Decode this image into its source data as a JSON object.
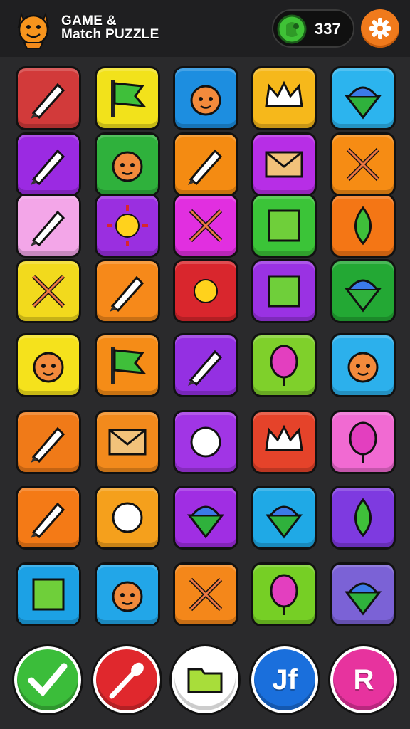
{
  "header": {
    "title_line1": "GAME &",
    "title_line2": "Match PUZZLE",
    "coin_count": "337"
  },
  "colors": {
    "background": "#2a2a2c",
    "topbar": "#1f1f21",
    "settings": "#f07a1c",
    "coin": "#3fc236"
  },
  "grid_tiles": [
    {
      "icon": "marker-icon",
      "bg": "#d23a3a"
    },
    {
      "icon": "green-flag-icon",
      "bg": "#f2e21b"
    },
    {
      "icon": "horse-chess-icon",
      "bg": "#1d8ee0"
    },
    {
      "icon": "green-crown-icon",
      "bg": "#f6b81b"
    },
    {
      "icon": "spinning-top-icon",
      "bg": "#2cb4ee"
    },
    {
      "icon": "brush-tool-icon",
      "bg": "#9b2ae2"
    },
    {
      "icon": "devil-face-icon",
      "bg": "#2fb13c"
    },
    {
      "icon": "knife-icon",
      "bg": "#f48b12"
    },
    {
      "icon": "envelope-icon",
      "bg": "#b72ee6"
    },
    {
      "icon": "airplane-icon",
      "bg": "#f68c14"
    },
    {
      "icon": "pencil-icon",
      "bg": "#f3a6e8"
    },
    {
      "icon": "white-sun-icon",
      "bg": "#9a2fe0"
    },
    {
      "icon": "scissors-icon",
      "bg": "#e12fe0"
    },
    {
      "icon": "game-sign-icon",
      "bg": "#3bc438"
    },
    {
      "icon": "green-drop-icon",
      "bg": "#f47615"
    },
    {
      "icon": "crossed-tools-icon",
      "bg": "#f2da1d"
    },
    {
      "icon": "trumpet-icon",
      "bg": "#f6891a"
    },
    {
      "icon": "sun-icon",
      "bg": "#d9262d"
    },
    {
      "icon": "sword-box-icon",
      "bg": "#9a32e3"
    },
    {
      "icon": "paint-tube-icon",
      "bg": "#23a834"
    },
    {
      "icon": "phoenix-icon",
      "bg": "#f5e21c"
    },
    {
      "icon": "sign-post-icon",
      "bg": "#f58c17"
    },
    {
      "icon": "gold-pen-icon",
      "bg": "#9430e2"
    },
    {
      "icon": "balloon-icon",
      "bg": "#7fd02b"
    },
    {
      "icon": "hooded-figure-icon",
      "bg": "#2cb0ec"
    },
    {
      "icon": "pen-nib-icon",
      "bg": "#f07a18"
    },
    {
      "icon": "paper-envelope-icon",
      "bg": "#f28a1c"
    },
    {
      "icon": "chat-bubble-icon",
      "bg": "#a135e5"
    },
    {
      "icon": "white-crown-icon",
      "bg": "#e5432a"
    },
    {
      "icon": "pink-swirl-icon",
      "bg": "#f16ad2"
    },
    {
      "icon": "blue-pencil-icon",
      "bg": "#f47a16"
    },
    {
      "icon": "blue-orb-icon",
      "bg": "#f5a01c"
    },
    {
      "icon": "ice-cream-icon",
      "bg": "#a02ee3"
    },
    {
      "icon": "purple-cup-icon",
      "bg": "#1fa9e6"
    },
    {
      "icon": "green-fish-icon",
      "bg": "#7e3ae0"
    },
    {
      "icon": "green-square-icon",
      "bg": "#1ca1e5"
    },
    {
      "icon": "fox-face-icon",
      "bg": "#22a6e8"
    },
    {
      "icon": "crossed-sticks-icon",
      "bg": "#f4871a"
    },
    {
      "icon": "parrot-icon",
      "bg": "#76cf25"
    },
    {
      "icon": "shell-top-icon",
      "bg": "#7b62d6"
    }
  ],
  "bottom_buttons": [
    {
      "name": "confirm-button",
      "icon": "checkmark-icon",
      "bg": "#3bbd3a",
      "label": ""
    },
    {
      "name": "brush-button",
      "icon": "brush-icon",
      "bg": "#e0282d",
      "label": ""
    },
    {
      "name": "folder-button",
      "icon": "folder-icon",
      "bg": "#ffffff",
      "label": ""
    },
    {
      "name": "jf-button",
      "icon": "",
      "bg": "#1a6fdc",
      "label": "Jf"
    },
    {
      "name": "r-button",
      "icon": "",
      "bg": "#e7339e",
      "label": "R"
    }
  ]
}
